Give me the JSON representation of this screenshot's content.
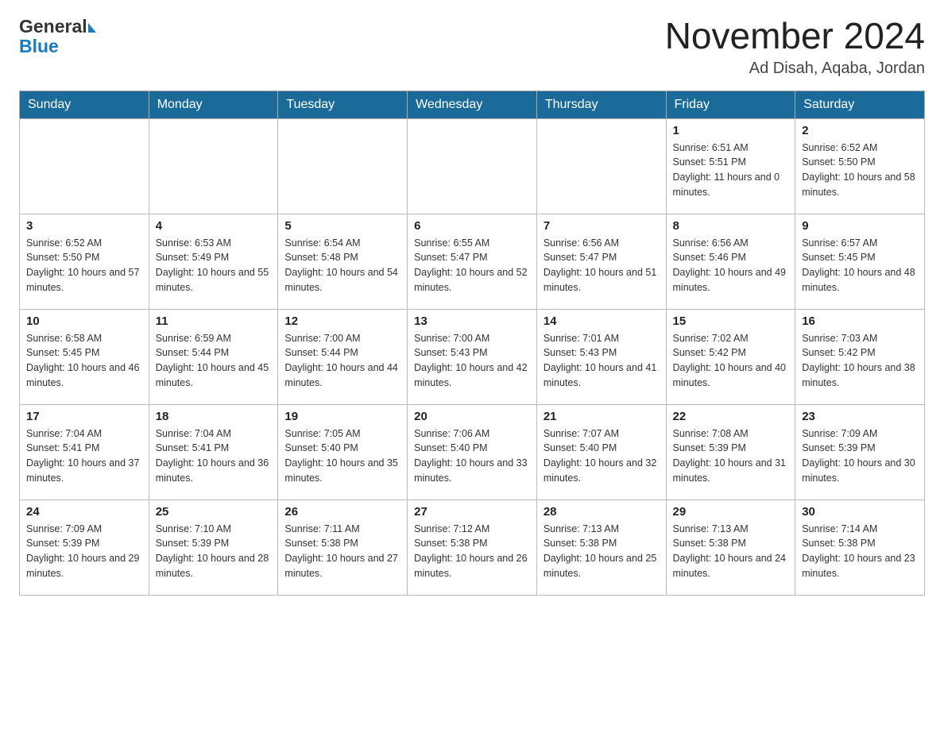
{
  "header": {
    "logo_general": "General",
    "logo_blue": "Blue",
    "month_title": "November 2024",
    "location": "Ad Disah, Aqaba, Jordan"
  },
  "days_of_week": [
    "Sunday",
    "Monday",
    "Tuesday",
    "Wednesday",
    "Thursday",
    "Friday",
    "Saturday"
  ],
  "weeks": [
    [
      {
        "day": "",
        "info": ""
      },
      {
        "day": "",
        "info": ""
      },
      {
        "day": "",
        "info": ""
      },
      {
        "day": "",
        "info": ""
      },
      {
        "day": "",
        "info": ""
      },
      {
        "day": "1",
        "info": "Sunrise: 6:51 AM\nSunset: 5:51 PM\nDaylight: 11 hours and 0 minutes."
      },
      {
        "day": "2",
        "info": "Sunrise: 6:52 AM\nSunset: 5:50 PM\nDaylight: 10 hours and 58 minutes."
      }
    ],
    [
      {
        "day": "3",
        "info": "Sunrise: 6:52 AM\nSunset: 5:50 PM\nDaylight: 10 hours and 57 minutes."
      },
      {
        "day": "4",
        "info": "Sunrise: 6:53 AM\nSunset: 5:49 PM\nDaylight: 10 hours and 55 minutes."
      },
      {
        "day": "5",
        "info": "Sunrise: 6:54 AM\nSunset: 5:48 PM\nDaylight: 10 hours and 54 minutes."
      },
      {
        "day": "6",
        "info": "Sunrise: 6:55 AM\nSunset: 5:47 PM\nDaylight: 10 hours and 52 minutes."
      },
      {
        "day": "7",
        "info": "Sunrise: 6:56 AM\nSunset: 5:47 PM\nDaylight: 10 hours and 51 minutes."
      },
      {
        "day": "8",
        "info": "Sunrise: 6:56 AM\nSunset: 5:46 PM\nDaylight: 10 hours and 49 minutes."
      },
      {
        "day": "9",
        "info": "Sunrise: 6:57 AM\nSunset: 5:45 PM\nDaylight: 10 hours and 48 minutes."
      }
    ],
    [
      {
        "day": "10",
        "info": "Sunrise: 6:58 AM\nSunset: 5:45 PM\nDaylight: 10 hours and 46 minutes."
      },
      {
        "day": "11",
        "info": "Sunrise: 6:59 AM\nSunset: 5:44 PM\nDaylight: 10 hours and 45 minutes."
      },
      {
        "day": "12",
        "info": "Sunrise: 7:00 AM\nSunset: 5:44 PM\nDaylight: 10 hours and 44 minutes."
      },
      {
        "day": "13",
        "info": "Sunrise: 7:00 AM\nSunset: 5:43 PM\nDaylight: 10 hours and 42 minutes."
      },
      {
        "day": "14",
        "info": "Sunrise: 7:01 AM\nSunset: 5:43 PM\nDaylight: 10 hours and 41 minutes."
      },
      {
        "day": "15",
        "info": "Sunrise: 7:02 AM\nSunset: 5:42 PM\nDaylight: 10 hours and 40 minutes."
      },
      {
        "day": "16",
        "info": "Sunrise: 7:03 AM\nSunset: 5:42 PM\nDaylight: 10 hours and 38 minutes."
      }
    ],
    [
      {
        "day": "17",
        "info": "Sunrise: 7:04 AM\nSunset: 5:41 PM\nDaylight: 10 hours and 37 minutes."
      },
      {
        "day": "18",
        "info": "Sunrise: 7:04 AM\nSunset: 5:41 PM\nDaylight: 10 hours and 36 minutes."
      },
      {
        "day": "19",
        "info": "Sunrise: 7:05 AM\nSunset: 5:40 PM\nDaylight: 10 hours and 35 minutes."
      },
      {
        "day": "20",
        "info": "Sunrise: 7:06 AM\nSunset: 5:40 PM\nDaylight: 10 hours and 33 minutes."
      },
      {
        "day": "21",
        "info": "Sunrise: 7:07 AM\nSunset: 5:40 PM\nDaylight: 10 hours and 32 minutes."
      },
      {
        "day": "22",
        "info": "Sunrise: 7:08 AM\nSunset: 5:39 PM\nDaylight: 10 hours and 31 minutes."
      },
      {
        "day": "23",
        "info": "Sunrise: 7:09 AM\nSunset: 5:39 PM\nDaylight: 10 hours and 30 minutes."
      }
    ],
    [
      {
        "day": "24",
        "info": "Sunrise: 7:09 AM\nSunset: 5:39 PM\nDaylight: 10 hours and 29 minutes."
      },
      {
        "day": "25",
        "info": "Sunrise: 7:10 AM\nSunset: 5:39 PM\nDaylight: 10 hours and 28 minutes."
      },
      {
        "day": "26",
        "info": "Sunrise: 7:11 AM\nSunset: 5:38 PM\nDaylight: 10 hours and 27 minutes."
      },
      {
        "day": "27",
        "info": "Sunrise: 7:12 AM\nSunset: 5:38 PM\nDaylight: 10 hours and 26 minutes."
      },
      {
        "day": "28",
        "info": "Sunrise: 7:13 AM\nSunset: 5:38 PM\nDaylight: 10 hours and 25 minutes."
      },
      {
        "day": "29",
        "info": "Sunrise: 7:13 AM\nSunset: 5:38 PM\nDaylight: 10 hours and 24 minutes."
      },
      {
        "day": "30",
        "info": "Sunrise: 7:14 AM\nSunset: 5:38 PM\nDaylight: 10 hours and 23 minutes."
      }
    ]
  ]
}
